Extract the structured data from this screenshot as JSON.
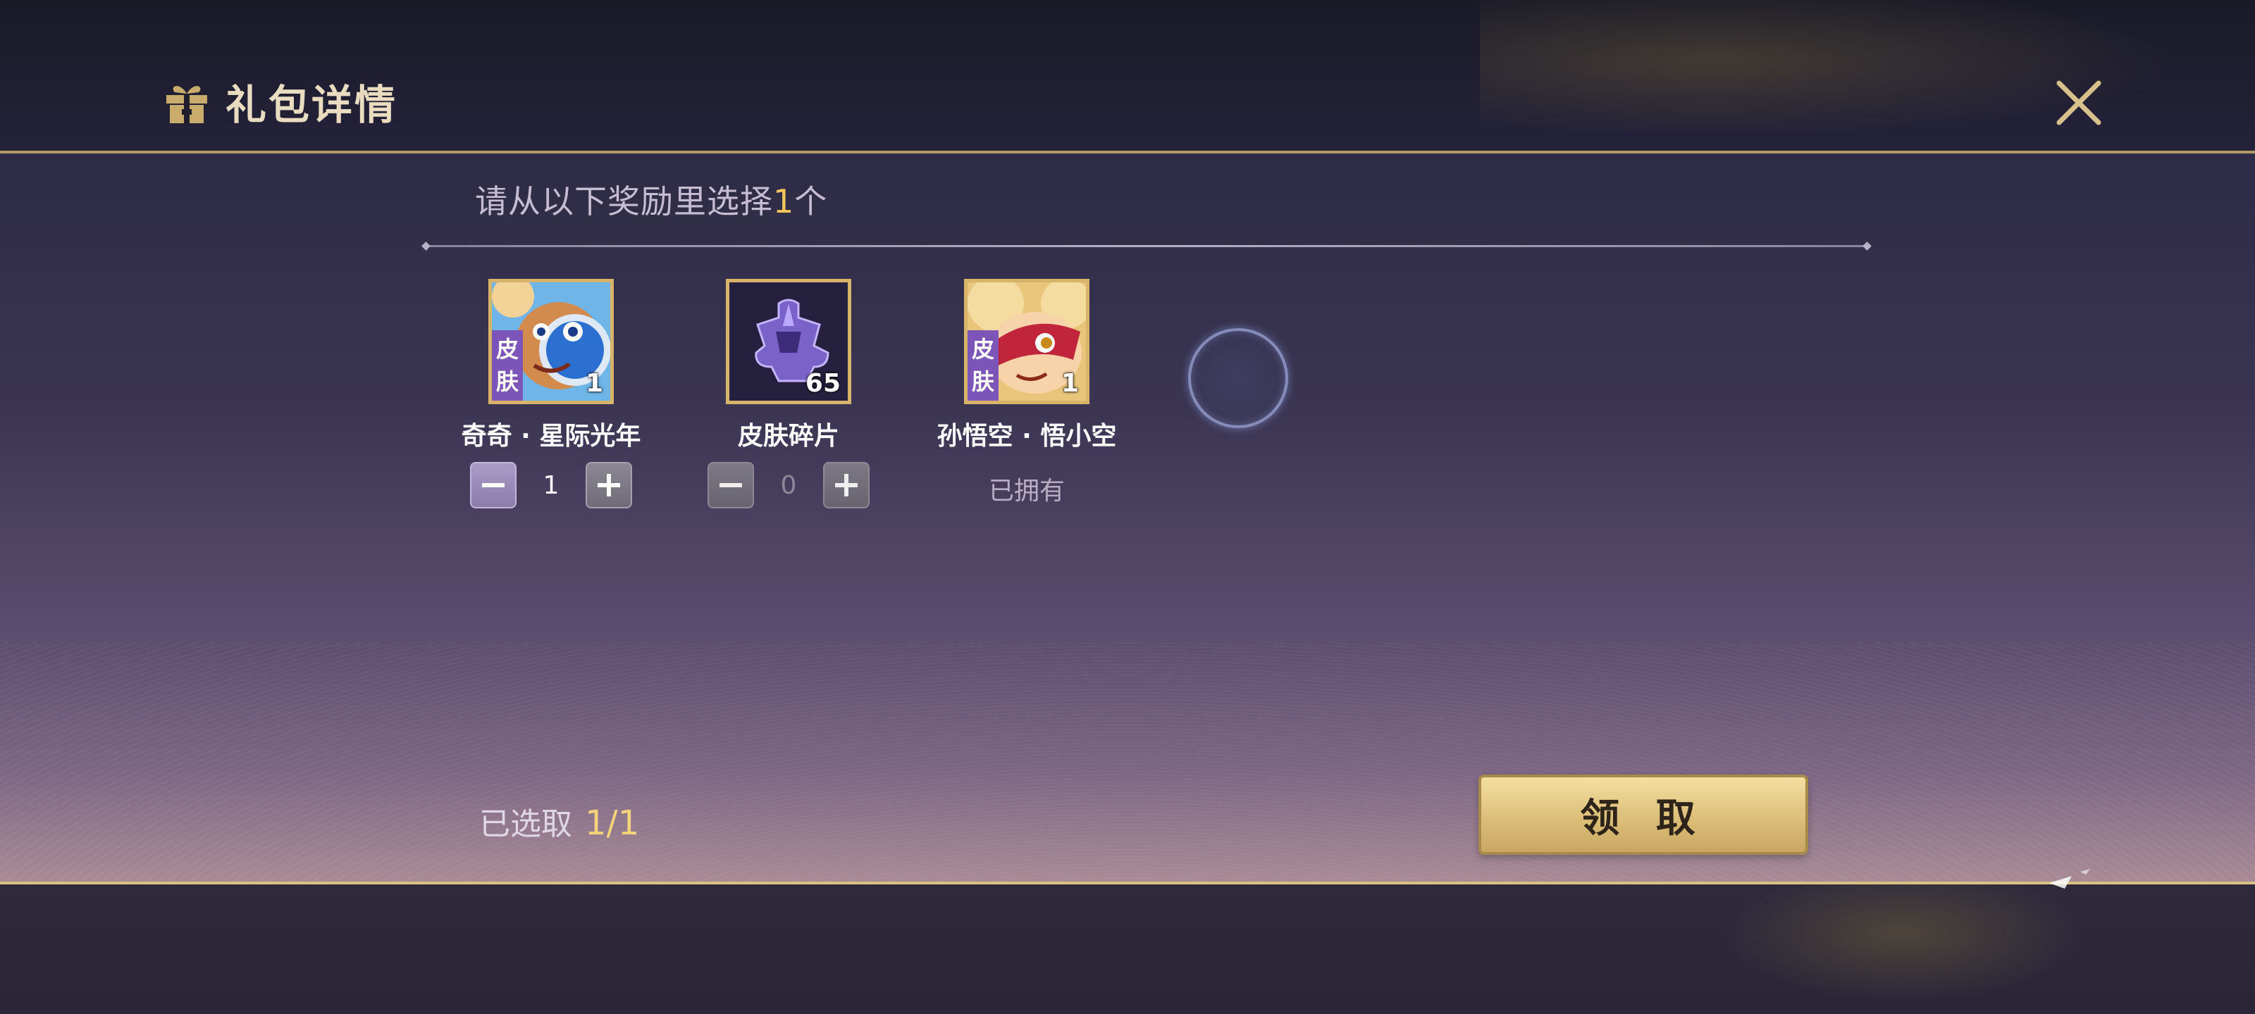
{
  "header": {
    "title": "礼包详情",
    "icon": "gift-icon",
    "close_icon": "close-icon"
  },
  "prompt": {
    "prefix": "请从以下奖励里选择",
    "count": "1",
    "suffix": "个"
  },
  "items": [
    {
      "name": "奇奇 · 星际光年",
      "tag_line1": "皮",
      "tag_line2": "肤",
      "count": "1",
      "stepper_value": "1",
      "state": "selectable"
    },
    {
      "name": "皮肤碎片",
      "count": "65",
      "stepper_value": "0",
      "state": "selectable"
    },
    {
      "name": "孙悟空 · 悟小空",
      "tag_line1": "皮",
      "tag_line2": "肤",
      "count": "1",
      "status": "已拥有",
      "state": "owned"
    }
  ],
  "footer": {
    "selected_label": "已选取",
    "selected_value": "1/1",
    "claim_label": "领 取"
  },
  "colors": {
    "gold_accent": "#f2c45c",
    "frame_gold": "#d8b46a",
    "skin_tag": "#7d55b8"
  }
}
